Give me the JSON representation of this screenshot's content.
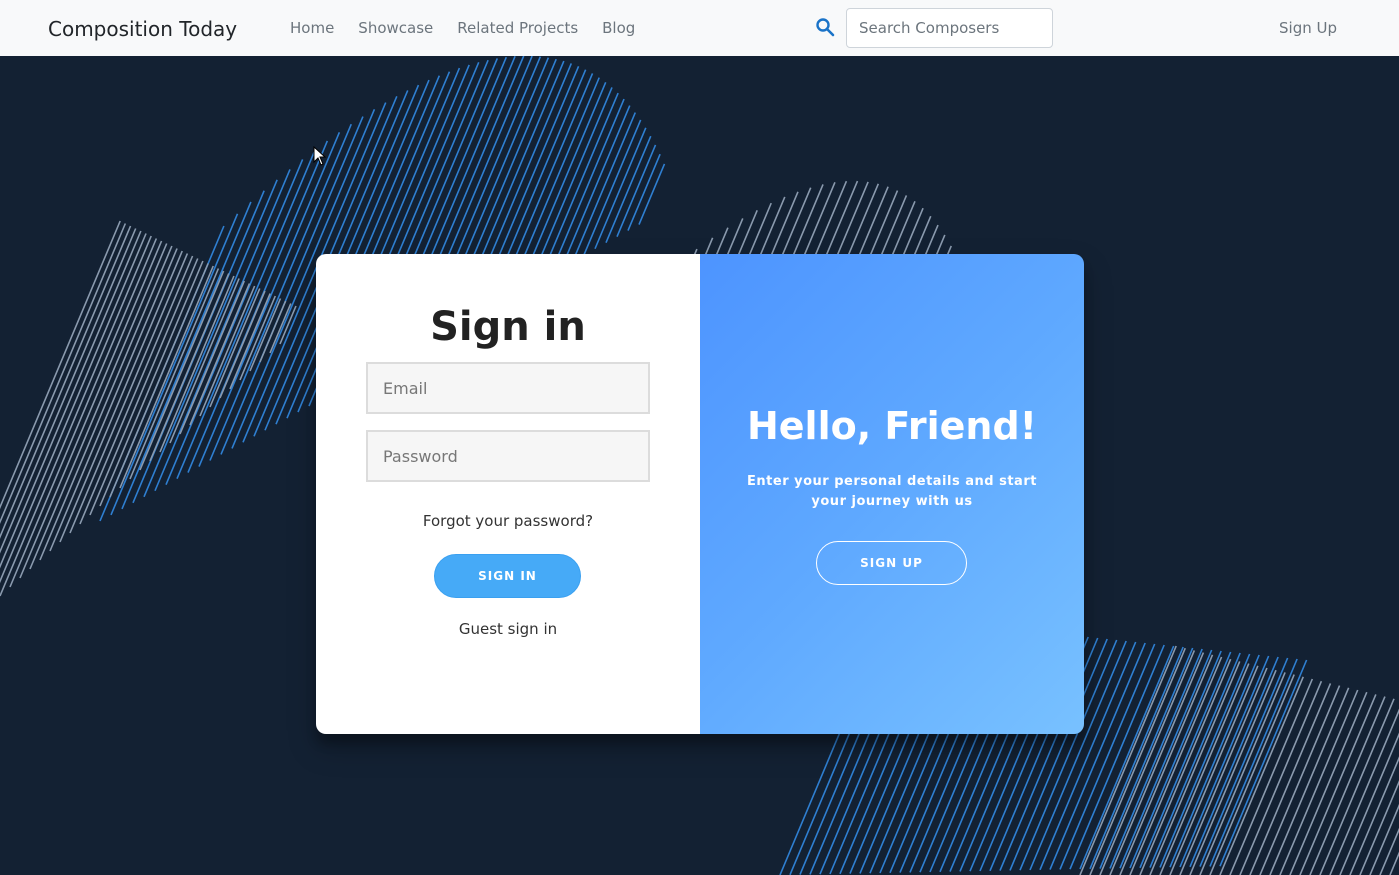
{
  "navbar": {
    "brand": "Composition Today",
    "links": [
      "Home",
      "Showcase",
      "Related Projects",
      "Blog"
    ],
    "search_placeholder": "Search Composers",
    "search_icon": "search-icon",
    "signup_label": "Sign Up"
  },
  "signin": {
    "title": "Sign in",
    "email_placeholder": "Email",
    "password_placeholder": "Password",
    "forgot_label": "Forgot your password?",
    "button_label": "SIGN IN",
    "guest_label": "Guest sign in"
  },
  "overlay": {
    "title": "Hello, Friend!",
    "text": "Enter your personal details and start your journey with us",
    "button_label": "SIGN UP"
  },
  "colors": {
    "background": "#132133",
    "accent": "#46aaf7",
    "gradient_start": "#4d94ff",
    "gradient_end": "#78c1ff"
  }
}
